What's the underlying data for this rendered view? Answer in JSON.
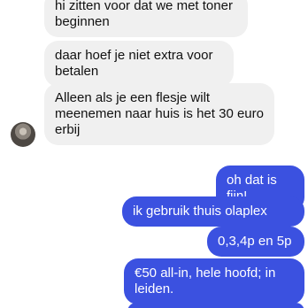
{
  "messages": {
    "incoming": [
      "hi zitten voor dat we met toner beginnen",
      "daar hoef je niet extra voor betalen",
      "Alleen als je een flesje wilt meenemen naar huis is het 30 euro erbij"
    ],
    "outgoing": [
      "oh dat is fijn!",
      "ik gebruik thuis olaplex",
      "0,3,4p en 5p",
      "€50 all-in, hele hoofd; in leiden."
    ]
  },
  "colors": {
    "incoming_bg": "#f0f0f0",
    "outgoing_bg": "#3b51e0"
  }
}
